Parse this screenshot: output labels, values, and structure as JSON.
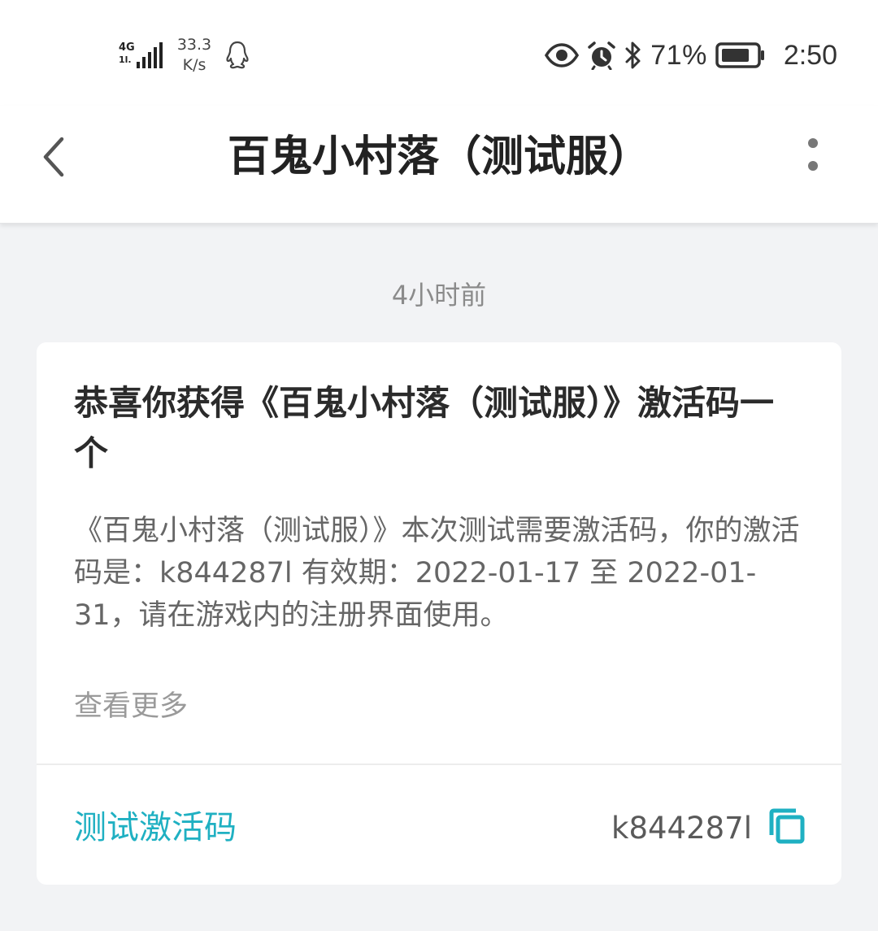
{
  "status_bar": {
    "network_type": "4G",
    "network_sub": "1l.",
    "speed_value": "33.3",
    "speed_unit": "K/s",
    "battery_percent": "71%",
    "time": "2:50",
    "icons": [
      "signal-icon",
      "qq-icon",
      "eye-icon",
      "alarm-icon",
      "bluetooth-icon",
      "battery-icon"
    ]
  },
  "header": {
    "title": "百鬼小村落（测试服）",
    "back_icon": "chevron-left-icon",
    "more_icon": "more-vertical-icon"
  },
  "message": {
    "timestamp": "4小时前",
    "title": "恭喜你获得《百鬼小村落（测试服）》激活码一个",
    "body": "《百鬼小村落（测试服）》本次测试需要激活码，你的激活码是：k844287l 有效期：2022-01-17 至 2022-01-31，请在游戏内的注册界面使用。",
    "see_more": "查看更多",
    "code_label": "测试激活码",
    "code_value": "k844287l",
    "copy_icon": "copy-icon"
  },
  "colors": {
    "accent": "#1fb0c2",
    "background": "#f2f3f5",
    "card": "#ffffff"
  }
}
